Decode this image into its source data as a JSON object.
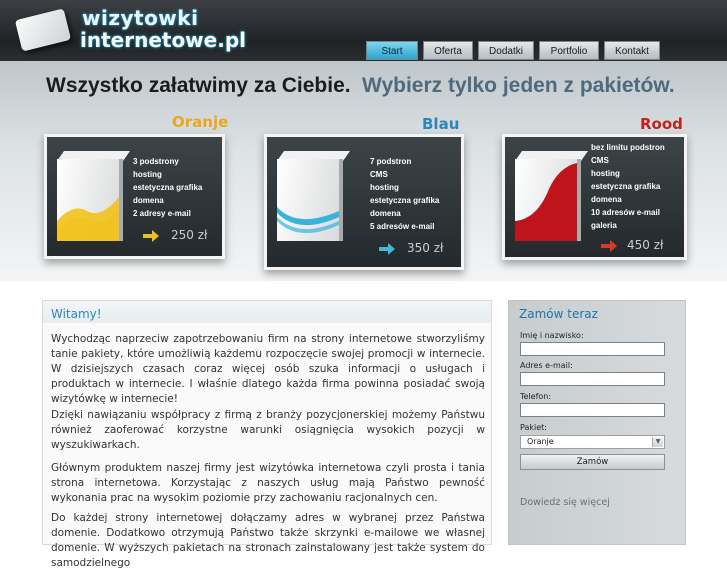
{
  "logo": {
    "line1": "wizytowki",
    "line2": "internetowe.pl"
  },
  "nav": {
    "items": [
      "Start",
      "Oferta",
      "Dodatki",
      "Portfolio",
      "Kontakt"
    ],
    "active": "Start"
  },
  "banner": {
    "slogan_primary": "Wszystko załatwimy za Ciebie.",
    "slogan_secondary": "Wybierz tylko jeden z pakietów."
  },
  "packages": [
    {
      "name": "Oranje",
      "color": "#e8a81e",
      "features": [
        "3 podstrony",
        "hosting",
        "estetyczna grafika",
        "domena",
        "2 adresy e-mail"
      ],
      "price": "250 zł",
      "arrow_color": "#e8c21e",
      "box_accent": "#f2c21a"
    },
    {
      "name": "Blau",
      "color": "#2b86b9",
      "features": [
        "7 podstron",
        "CMS",
        "hosting",
        "estetyczna grafika",
        "domena",
        "5 adresów e-mail"
      ],
      "price": "350 zł",
      "arrow_color": "#45b6d9",
      "box_accent": "#38b3dc"
    },
    {
      "name": "Rood",
      "color": "#c0241f",
      "features": [
        "bez limitu podstron",
        "CMS",
        "hosting",
        "estetyczna grafika",
        "domena",
        "10 adresów e-mail",
        "galeria"
      ],
      "price": "450 zł",
      "arrow_color": "#d83a2a",
      "box_accent": "#c0141c"
    }
  ],
  "main": {
    "title": "Witamy!",
    "paragraphs": [
      "Wychodząc naprzeciw zapotrzebowaniu firm na strony internetowe stworzyliśmy tanie pakiety, które umożliwią każdemu rozpoczęcie swojej promocji w internecie. W dzisiejszych czasach coraz więcej osób szuka informacji o usługach i produktach w internecie. I właśnie dlatego każda firma powinna posiadać swoją wizytówkę w internecie!",
      "Dzięki nawiązaniu współpracy z firmą z branży pozycjonerskiej możemy Państwu również zaoferować korzystne warunki osiągnięcia wysokich pozycji w wyszukiwarkach.",
      "Głównym produktem naszej firmy jest wizytówka internetowa czyli prosta i tania strona internetowa. Korzystając z naszych usług mają Państwo pewność wykonania prac na wysokim poziomie przy zachowaniu racjonalnych cen.",
      "Do każdej strony internetowej dołączamy adres w wybranej przez Państwa domenie. Dodatkowo otrzymują Państwo także skrzynki e-mailowe we własnej domenie. W wyższych pakietach na stronach zainstalowany jest także system do samodzielnego"
    ]
  },
  "order": {
    "title": "Zamów teraz",
    "name_label": "Imię i nazwisko:",
    "email_label": "Adres e-mail:",
    "phone_label": "Telefon:",
    "package_label": "Pakiet:",
    "package_selected": "Oranje",
    "submit_label": "Zamów",
    "more_link": "Dowiedz się więcej"
  }
}
